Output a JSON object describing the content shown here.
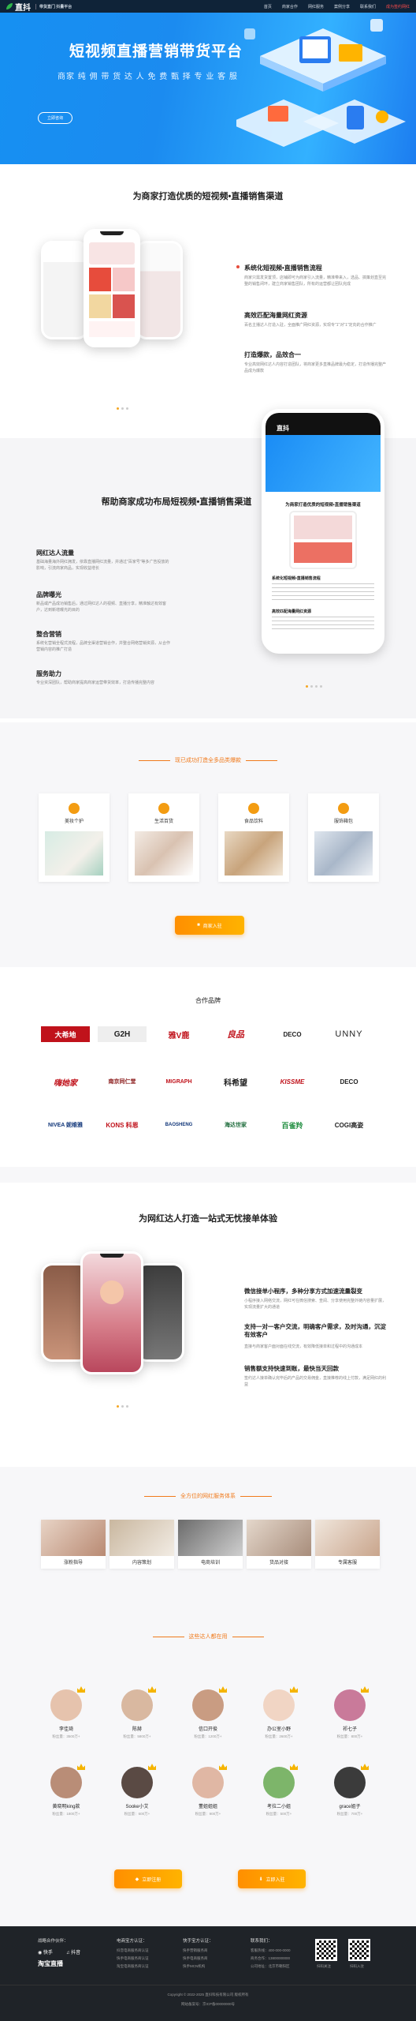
{
  "nav": {
    "logo": "直抖",
    "logo_sub": "带货直门 抖量平台",
    "links": [
      "首页",
      "商家合作",
      "网红服务",
      "案例分享",
      "联系我们",
      "成为签约网红"
    ]
  },
  "hero": {
    "title": "短视频直播营销带货平台",
    "subtitle": "商家 纯 佣 带 货 达 人 免 费 甄 择 专 业 客 服",
    "button": "立即咨询"
  },
  "section1": {
    "title": "为商家打造优质的短视频•直播销售渠道",
    "features": [
      {
        "title": "系统化短视频•直播销售流程",
        "desc": "商家只需发货置顶，店铺即可为商家引入流量，精准带来入，选品、搞策划直至完整的销售闭环，建立商家销售团队，所有的运营都让团队完成"
      },
      {
        "title": "高效匹配海量网红资源",
        "desc": "百名主播达人打造入驻，全面推广网红资源，实现专\"1\"对\"1\"定向的合作推广"
      },
      {
        "title": "打造爆款，品效合一",
        "desc": "专业高效网红达人内容打造团队，将商家更多直推品牌最为稳定，打造传播完整产品成为爆款"
      }
    ]
  },
  "section2": {
    "title": "帮助商家成功布局短视频•直播销售渠道",
    "features": [
      {
        "title": "网红达人流量",
        "desc": "基础海量海外网红拥发，依靠直播网红流量，并通过\"百家号\"等多广告投放的影响，引流商家商品，实现收益增长"
      },
      {
        "title": "品牌曝光",
        "desc": "新品或产品成功销售后，通过网红达人的视频、直播分享，精准触达有效客户，达到新增曝光的目的"
      },
      {
        "title": "整合营销",
        "desc": "系统化营销全程式流程，品牌全渠道营销合作，并整合网络营销资源，从合作营销内容的推广打造"
      },
      {
        "title": "服务助力",
        "desc": "专业资深团队，帮助商家提高商家运营带货效率，打造传播完整内容"
      }
    ],
    "phone_screen_title": "为商家打造优质的短视频•直播销售渠道",
    "phone_list_title": "系统化短视频•直播销售流程",
    "phone_list_title2": "高效匹配海量网红资源"
  },
  "categories": {
    "subtitle": "现已成功打造全多品类爆款",
    "items": [
      "美妆个护",
      "生活百货",
      "食品饮料",
      "服饰箱包"
    ],
    "button": "商家入驻"
  },
  "partners": {
    "title": "合作品牌",
    "brands": [
      "大希地",
      "G2H",
      "雅V鹿",
      "良品",
      "DECO",
      "UNNY",
      "嗨她家",
      "南京同仁堂",
      "MIGRAPH",
      "科希望",
      "KISSME",
      "DECO",
      "NIVEA 妮维雅",
      "KONS 科恩",
      "BAOSHENG",
      "海达世家",
      "百雀羚",
      "COGI高姿"
    ]
  },
  "section3": {
    "title": "为网红达人打造一站式无忧接单体验",
    "features": [
      {
        "title": "微信接单小程序，多种分享方式加速流量裂变",
        "desc": "小程序接入网络交流，网红可在微信搜索、查阅、分享使用完整外链内容量扩展，实现流量扩大的通道"
      },
      {
        "title": "支持一对一客户交流，明确客户需求，及时沟通，沉淀有效客户",
        "desc": "直接与商家客户面对面在线交流，有效降低接单和过程中的沟通成本"
      },
      {
        "title": "销售额支持快速到账，最快当天回款",
        "desc": "签约达人接单确认完毕后的产品的交易佣金，直接推荐的线上付款，满足网红的利益"
      }
    ]
  },
  "services": {
    "subtitle": "全方位的网红服务体系",
    "items": [
      "涨粉指导",
      "内容策划",
      "电商培训",
      "货品对接",
      "专属客服"
    ]
  },
  "influencers": {
    "subtitle": "这些达人都在用",
    "people": [
      {
        "name": "李佳琦",
        "fans": "粉丝量：3500万+"
      },
      {
        "name": "陈赫",
        "fans": "粉丝量：5800万+"
      },
      {
        "name": "信口开俊",
        "fans": "粉丝量：1200万+"
      },
      {
        "name": "办公室小野",
        "fans": "粉丝量：2600万+"
      },
      {
        "name": "祁七子",
        "fans": "粉丝量：800万+"
      },
      {
        "name": "黄晓明king款",
        "fans": "粉丝量：1800万+"
      },
      {
        "name": "Sooke小艾",
        "fans": "粉丝量：600万+"
      },
      {
        "name": "董姐姐姐",
        "fans": "粉丝量：900万+"
      },
      {
        "name": "考拉二小姐",
        "fans": "粉丝量：500万+"
      },
      {
        "name": "grace姐子",
        "fans": "粉丝量：700万+"
      }
    ]
  },
  "cta": {
    "left": "立即注册",
    "right": "立即入驻"
  },
  "footer": {
    "cols": [
      {
        "h": "战略合作伙伴：",
        "items": [
          "快手",
          "抖音",
          "淘宝直播"
        ]
      },
      {
        "h": "电商宝方认证：",
        "items": [
          "抖音电商服务商认证",
          "快手电商服务商认证",
          "淘宝电商服务商认证"
        ]
      },
      {
        "h": "快手宝方认证：",
        "items": [
          "快手营销服务商",
          "快手电商服务商",
          "快手MCN机构"
        ]
      },
      {
        "h": "联系我们：",
        "items": [
          "客服热线：400-000-0000",
          "商务合作：13800000000",
          "公司地址：北京市朝阳区"
        ]
      }
    ],
    "qr_labels": [
      "扫码关注",
      "扫码入驻"
    ],
    "copyright": "Copyright © 2022-2025 直抖科技有限公司 版权所有",
    "icp": "网站备案号：京ICP备00000000号"
  }
}
